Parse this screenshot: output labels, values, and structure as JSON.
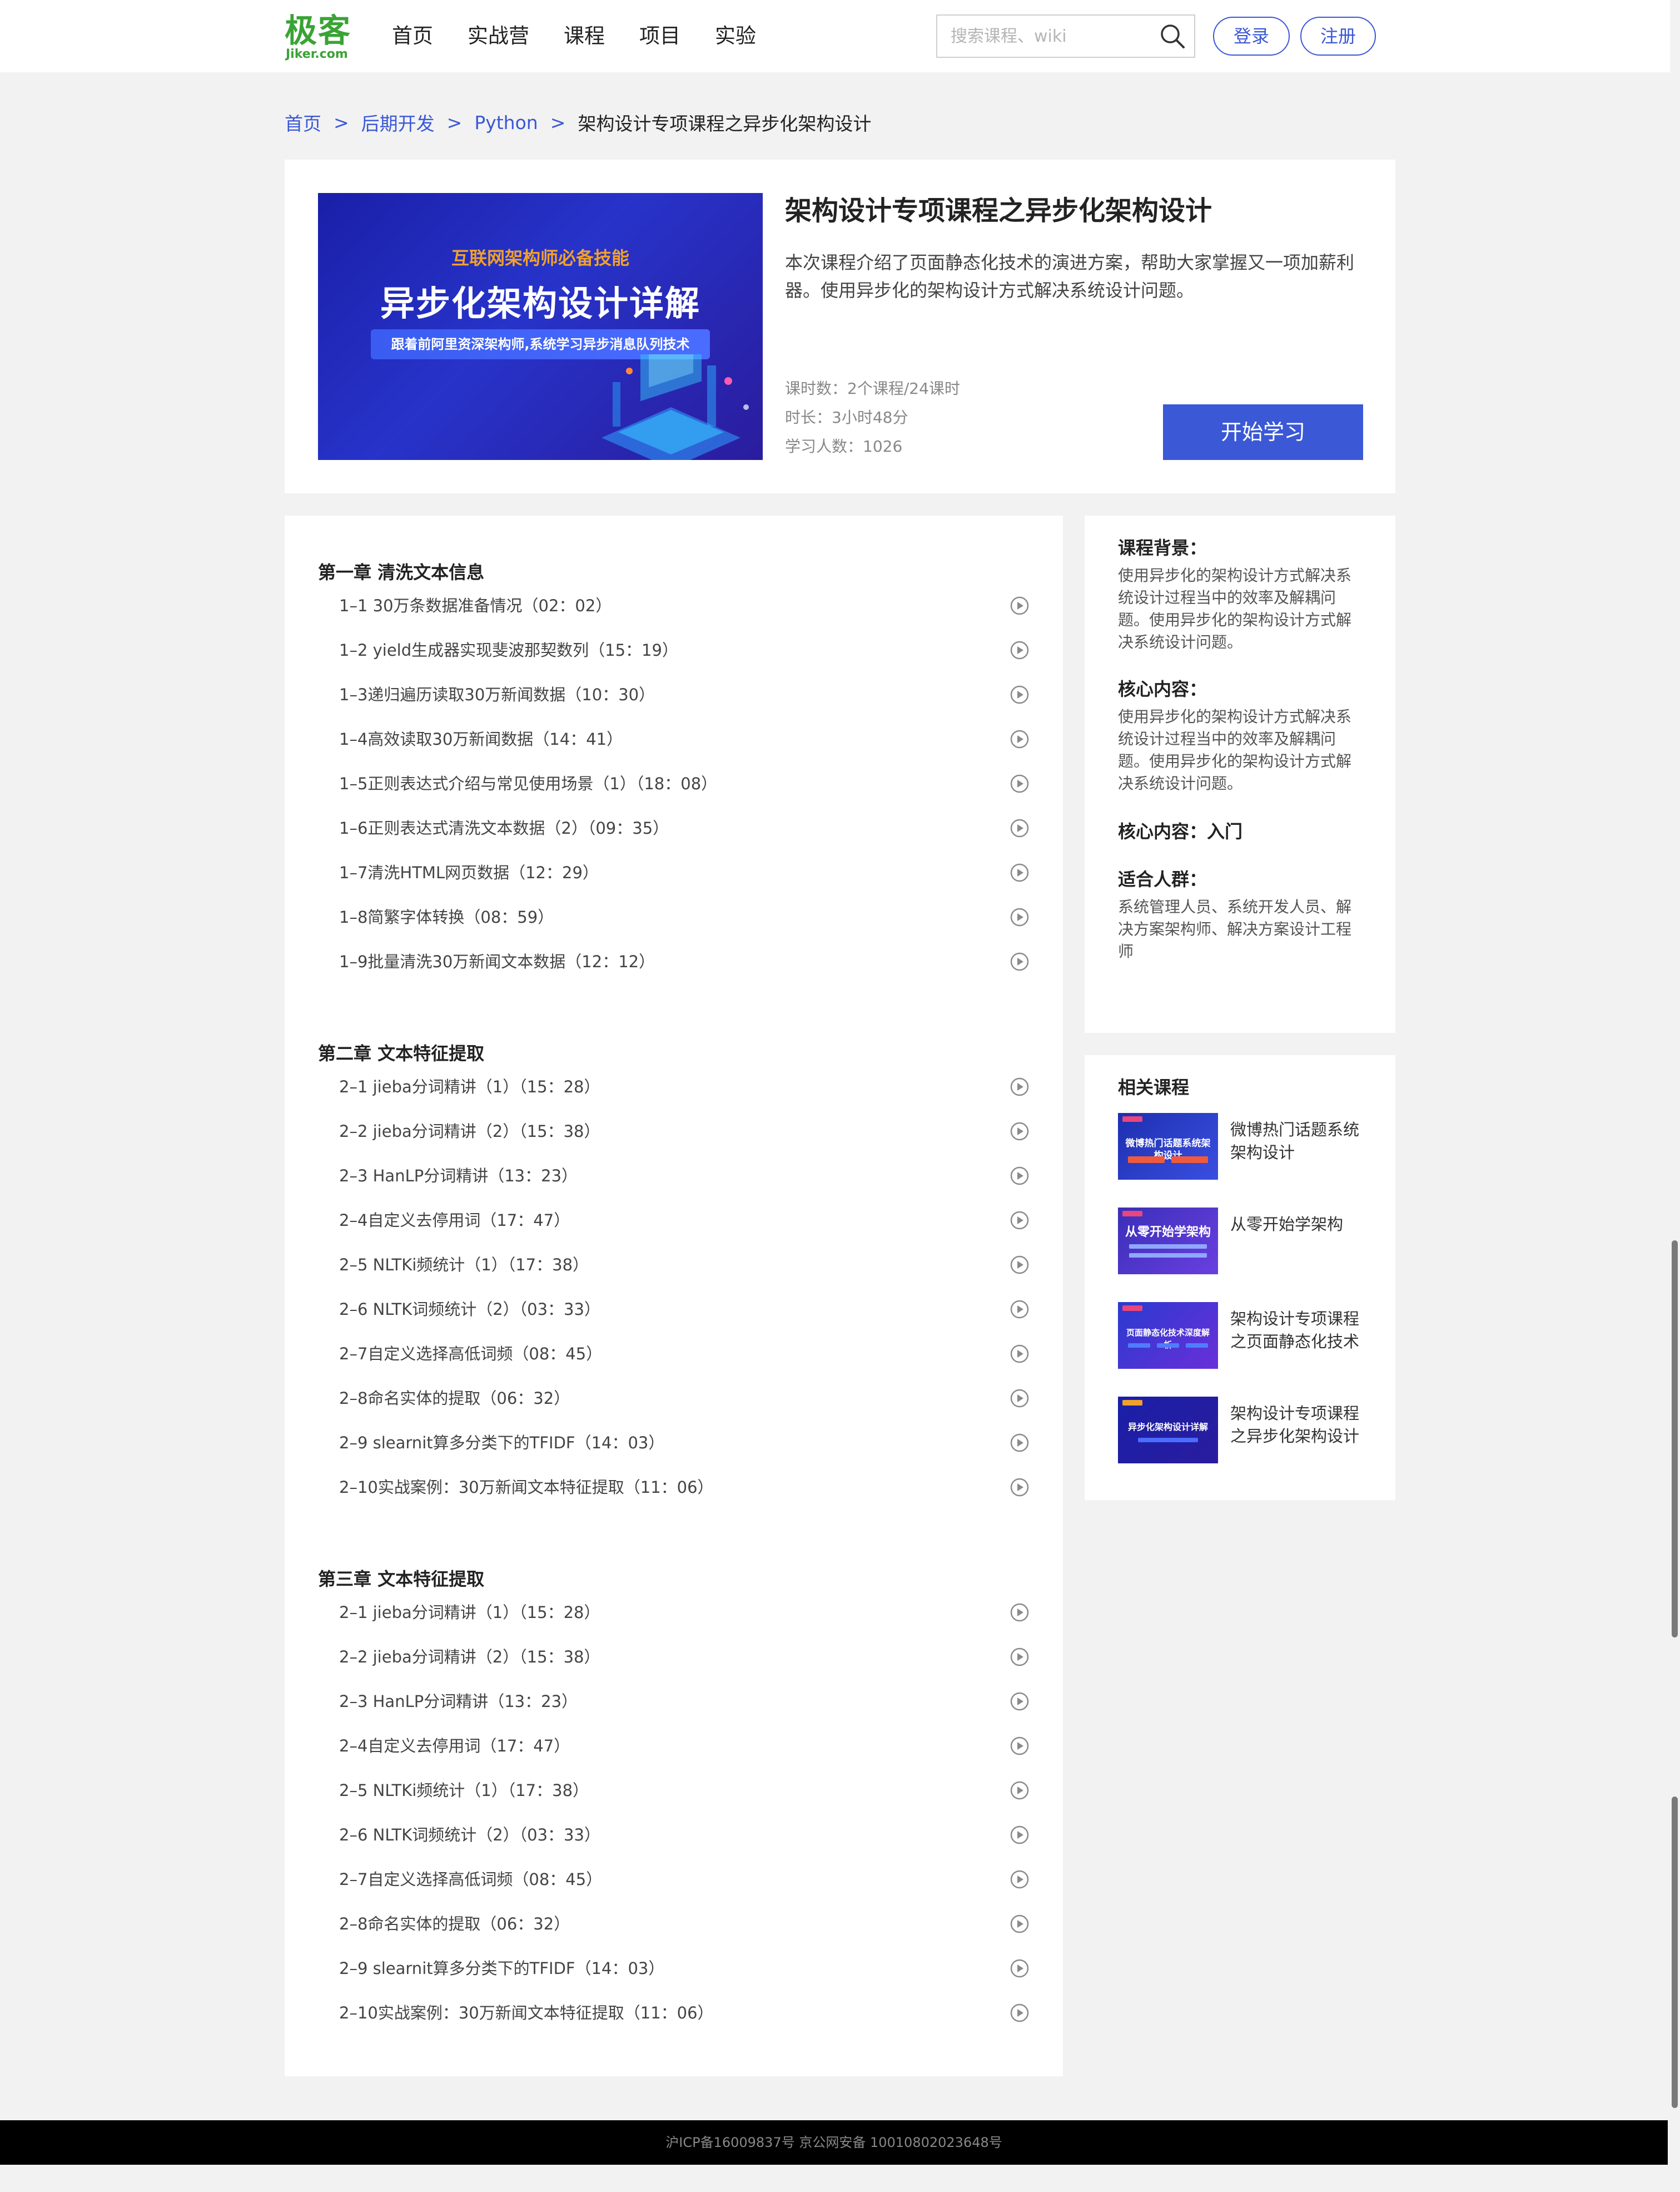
{
  "header": {
    "logo_cn": "极客",
    "logo_en": "Jiker.com",
    "brand_color": "#3aa335",
    "nav": [
      "首页",
      "实战营",
      "课程",
      "项目",
      "实验"
    ],
    "search_placeholder": "搜索课程、wiki",
    "login_label": "登录",
    "register_label": "注册",
    "accent_color": "#3b58d6"
  },
  "breadcrumb": {
    "items": [
      "首页",
      "后期开发",
      "Python"
    ],
    "separator": ">",
    "current": "架构设计专项课程之异步化架构设计"
  },
  "course": {
    "cover": {
      "tag": "互联网架构师必备技能",
      "title": "异步化架构设计详解",
      "subtitle": "跟着前阿里资深架构师,系统学习异步消息队列技术"
    },
    "title": "架构设计专项课程之异步化架构设计",
    "description": "本次课程介绍了页面静态化技术的演进方案，帮助大家掌握又一项加薪利器。使用异步化的架构设计方式解决系统设计问题。",
    "meta": [
      "课时数：2个课程/24课时",
      "时长：3小时48分",
      "学习人数：1026"
    ],
    "start_label": "开始学习"
  },
  "chapters": [
    {
      "title": "第一章 清洗文本信息",
      "lessons": [
        "1–1 30万条数据准备情况（02：02）",
        "1–2 yield生成器实现斐波那契数列（15：19）",
        "1–3递归遍历读取30万新闻数据（10：30）",
        "1–4高效读取30万新闻数据（14：41）",
        "1–5正则表达式介绍与常见使用场景（1）（18：08）",
        "1–6正则表达式清洗文本数据（2）（09：35）",
        "1–7清洗HTML网页数据（12：29）",
        "1–8简繁字体转换（08：59）",
        "1–9批量清洗30万新闻文本数据（12：12）"
      ]
    },
    {
      "title": "第二章 文本特征提取",
      "lessons": [
        "2–1 jieba分词精讲（1）（15：28）",
        "2–2 jieba分词精讲（2）（15：38）",
        "2–3 HanLP分词精讲（13：23）",
        "2–4自定义去停用词（17：47）",
        "2–5 NLTKi频统计（1）（17：38）",
        "2–6 NLTK词频统计（2）（03：33）",
        "2–7自定义选择高低词频（08：45）",
        "2–8命名实体的提取（06：32）",
        "2–9 slearnit算多分类下的TFIDF（14：03）",
        "2–10实战案例：30万新闻文本特征提取（11：06）"
      ]
    },
    {
      "title": "第三章 文本特征提取",
      "lessons": [
        "2–1 jieba分词精讲（1）（15：28）",
        "2–2 jieba分词精讲（2）（15：38）",
        "2–3 HanLP分词精讲（13：23）",
        "2–4自定义去停用词（17：47）",
        "2–5 NLTKi频统计（1）（17：38）",
        "2–6 NLTK词频统计（2）（03：33）",
        "2–7自定义选择高低词频（08：45）",
        "2–8命名实体的提取（06：32）",
        "2–9 slearnit算多分类下的TFIDF（14：03）",
        "2–10实战案例：30万新闻文本特征提取（11：06）"
      ]
    }
  ],
  "sidebar": {
    "background_title": "课程背景：",
    "background_text": "使用异步化的架构设计方式解决系统设计过程当中的效率及解耦问题。使用异步化的架构设计方式解决系统设计问题。",
    "core_title": "核心内容：",
    "core_text": "使用异步化的架构设计方式解决系统设计过程当中的效率及解耦问题。使用异步化的架构设计方式解决系统设计问题。",
    "level": "核心内容：入门",
    "audience_title": "适合人群：",
    "audience_text": "系统管理人员、系统开发人员、解决方案架构师、解决方案设计工程师"
  },
  "related": {
    "title": "相关课程",
    "items": [
      {
        "name": "微博热门话题系统架构设计",
        "thumb_text": "微博热门话题系统架构设计"
      },
      {
        "name": "从零开始学架构",
        "thumb_text": "从零开始学架构"
      },
      {
        "name": "架构设计专项课程之页面静态化技术",
        "thumb_text": "页面静态化技术深度解析"
      },
      {
        "name": "架构设计专项课程之异步化架构设计",
        "thumb_text": "异步化架构设计详解"
      }
    ]
  },
  "footer": {
    "text": "沪ICP备16009837号 京公网安备 10010802023648号"
  }
}
